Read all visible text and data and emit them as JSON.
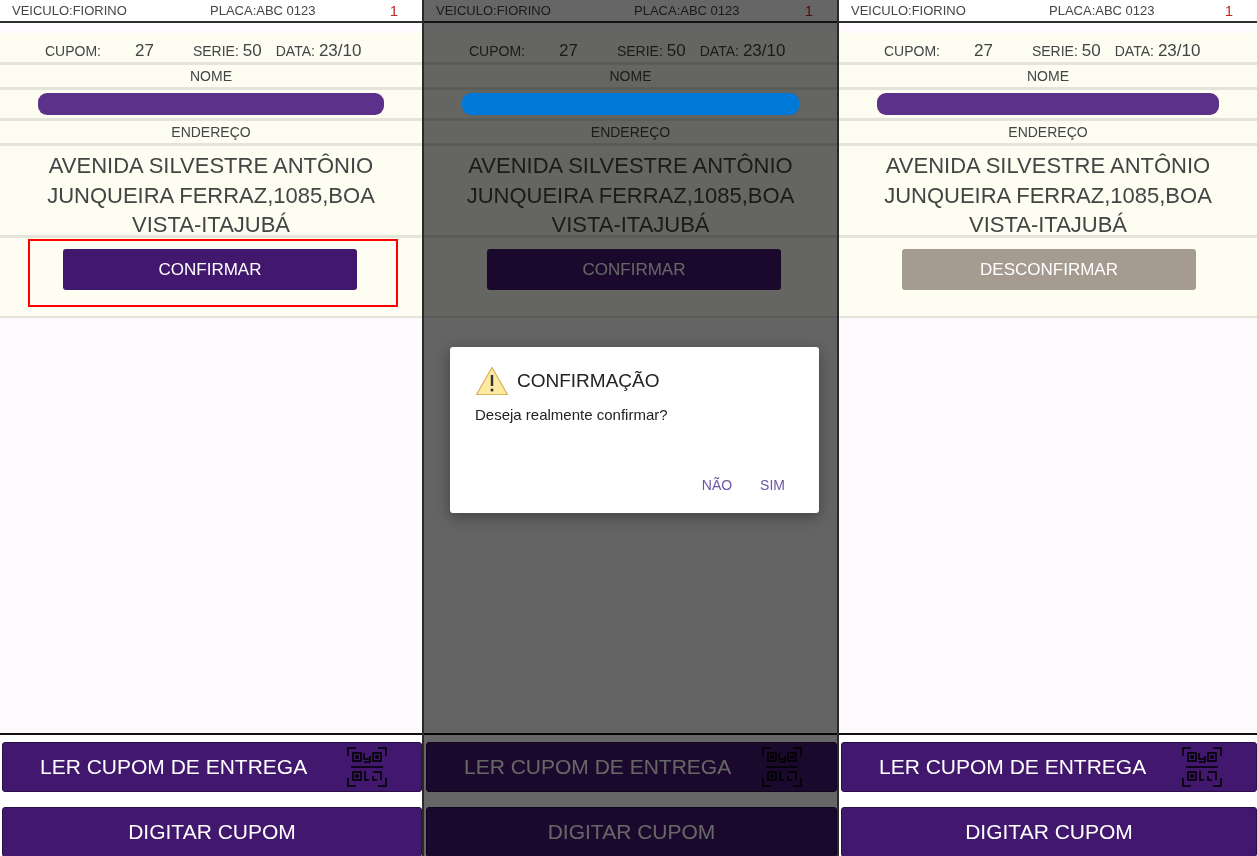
{
  "screens": [
    {
      "header": {
        "vehicle": "VEICULO:FIORINO",
        "plate": "PLACA:ABC 0123",
        "count": "1"
      },
      "coupon": {
        "coupon_label": "CUPOM:",
        "coupon_value": "27",
        "series_label": "SERIE:",
        "series_value": "50",
        "date_label": "DATA:",
        "date_value": "23/10"
      },
      "name_label": "NOME",
      "name_redaction": {
        "color": "#5c318a"
      },
      "address_label": "ENDEREÇO",
      "address": "AVENIDA SILVESTRE ANTÔNIO JUNQUEIRA FERRAZ,1085,BOA VISTA-ITAJUBÁ",
      "action_button": {
        "label": "CONFIRMAR",
        "kind": "confirm",
        "highlighted": true
      },
      "bottom_buttons": [
        {
          "label": "LER CUPOM DE ENTREGA",
          "kind": "scan"
        },
        {
          "label": "DIGITAR CUPOM",
          "kind": "plain"
        }
      ],
      "dimmed": false
    },
    {
      "header": {
        "vehicle": "VEICULO:FIORINO",
        "plate": "PLACA:ABC 0123",
        "count": "1"
      },
      "coupon": {
        "coupon_label": "CUPOM:",
        "coupon_value": "27",
        "series_label": "SERIE:",
        "series_value": "50",
        "date_label": "DATA:",
        "date_value": "23/10"
      },
      "name_label": "NOME",
      "name_redaction": {
        "color": "#0078d7"
      },
      "address_label": "ENDEREÇO",
      "address": "AVENIDA SILVESTRE ANTÔNIO JUNQUEIRA FERRAZ,1085,BOA VISTA-ITAJUBÁ",
      "action_button": {
        "label": "CONFIRMAR",
        "kind": "confirm",
        "highlighted": false
      },
      "bottom_buttons": [
        {
          "label": "LER CUPOM DE ENTREGA",
          "kind": "scan"
        },
        {
          "label": "DIGITAR CUPOM",
          "kind": "plain"
        }
      ],
      "dimmed": true,
      "dialog": {
        "title": "CONFIRMAÇÃO",
        "message": "Deseja realmente confirmar?",
        "buttons": [
          "NÃO",
          "SIM"
        ]
      }
    },
    {
      "header": {
        "vehicle": "VEICULO:FIORINO",
        "plate": "PLACA:ABC 0123",
        "count": "1"
      },
      "coupon": {
        "coupon_label": "CUPOM:",
        "coupon_value": "27",
        "series_label": "SERIE:",
        "series_value": "50",
        "date_label": "DATA:",
        "date_value": "23/10"
      },
      "name_label": "NOME",
      "name_redaction": {
        "color": "#5c318a"
      },
      "address_label": "ENDEREÇO",
      "address": "AVENIDA SILVESTRE ANTÔNIO JUNQUEIRA FERRAZ,1085,BOA VISTA-ITAJUBÁ",
      "action_button": {
        "label": "DESCONFIRMAR",
        "kind": "unconfirm",
        "highlighted": false
      },
      "bottom_buttons": [
        {
          "label": "LER CUPOM DE ENTREGA",
          "kind": "scan"
        },
        {
          "label": "DIGITAR CUPOM",
          "kind": "plain"
        }
      ],
      "dimmed": false
    }
  ]
}
